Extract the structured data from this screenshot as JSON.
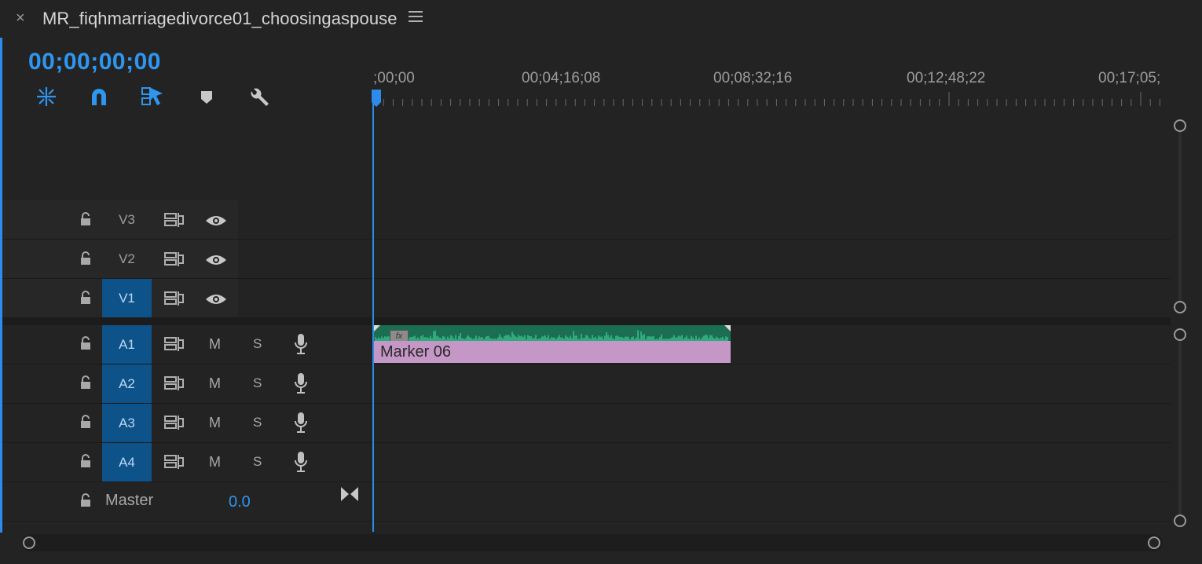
{
  "window": {
    "close_glyph": "×",
    "sequence_title": "MR_fiqhmarriagedivorce01_choosingaspouse",
    "menu_icon": "hamburger-menu-icon"
  },
  "timecode": "00;00;00;00",
  "toolbar": {
    "icons": [
      "nest-sequence-icon",
      "snap-magnet-icon",
      "linked-selection-icon",
      "add-marker-icon",
      "wrench-settings-icon"
    ]
  },
  "ruler": {
    "labels": [
      ";00;00",
      "00;04;16;08",
      "00;08;32;16",
      "00;12;48;22",
      "00;17;05;"
    ]
  },
  "video_tracks": [
    {
      "name": "V3",
      "targeted": false
    },
    {
      "name": "V2",
      "targeted": false
    },
    {
      "name": "V1",
      "targeted": true
    }
  ],
  "audio_tracks": [
    {
      "name": "A1",
      "mute": "M",
      "solo": "S"
    },
    {
      "name": "A2",
      "mute": "M",
      "solo": "S"
    },
    {
      "name": "A3",
      "mute": "M",
      "solo": "S"
    },
    {
      "name": "A4",
      "mute": "M",
      "solo": "S"
    }
  ],
  "master": {
    "label": "Master",
    "value": "0.0"
  },
  "clip": {
    "label": "Marker 06",
    "fx_badge": "fx"
  },
  "colors": {
    "accent": "#2d8ceb",
    "track_target": "#0d5288",
    "clip_wave": "#1b6e52",
    "clip_label_bg": "#c597c6",
    "background": "#232323"
  }
}
